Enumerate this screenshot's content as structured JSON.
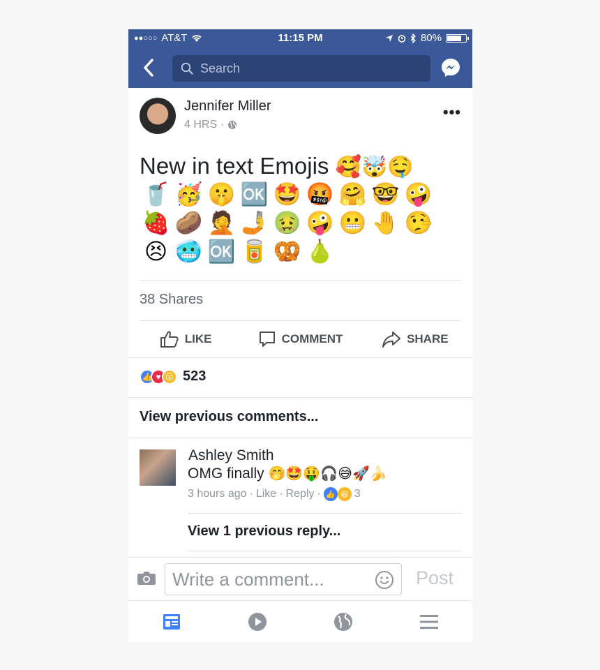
{
  "status_bar": {
    "signal": "●●○○○",
    "carrier": "AT&T",
    "time": "11:15 PM",
    "battery": "80%",
    "battery_level": 0.8
  },
  "header": {
    "search_placeholder": "Search",
    "back_icon": "chevron-left-icon",
    "messenger_icon": "messenger-icon",
    "bg_color": "#3b5998"
  },
  "post": {
    "author": "Jennifer Miller",
    "time": "4 HRS",
    "separator": "·",
    "text": "New in text Emojis",
    "title_emojis": "🥰🤯🤤",
    "emojis": [
      "🥤",
      "🥳",
      "🤫",
      "🆗",
      "🤩",
      "🤬",
      "🤗",
      "🤓",
      "🤪",
      "🍓",
      "🥔",
      "🤦",
      "🤳",
      "🤢",
      "🤪",
      "😬",
      "🤚",
      "🤥",
      "😣",
      "🥶",
      "🆗",
      "🥫",
      "🥨",
      "🍐"
    ],
    "shares": "38 Shares",
    "actions": {
      "like": "LIKE",
      "comment": "COMMENT",
      "share": "SHARE"
    },
    "reaction_count": "523"
  },
  "comments": {
    "view_previous": "View previous comments...",
    "items": [
      {
        "author": "Ashley Smith",
        "text": "OMG finally",
        "emojis": "🤭🤩🤑🎧😅🚀🍌",
        "time": "3 hours ago",
        "like": "Like",
        "reply": "Reply",
        "reaction_count": "3",
        "view_replies": "View 1 previous reply..."
      }
    ]
  },
  "composer": {
    "placeholder": "Write a comment...",
    "post_label": "Post"
  },
  "tabbar": {
    "tabs": [
      "news-feed-icon",
      "video-icon",
      "globe-icon",
      "menu-icon"
    ],
    "active_color": "#4080ff"
  }
}
